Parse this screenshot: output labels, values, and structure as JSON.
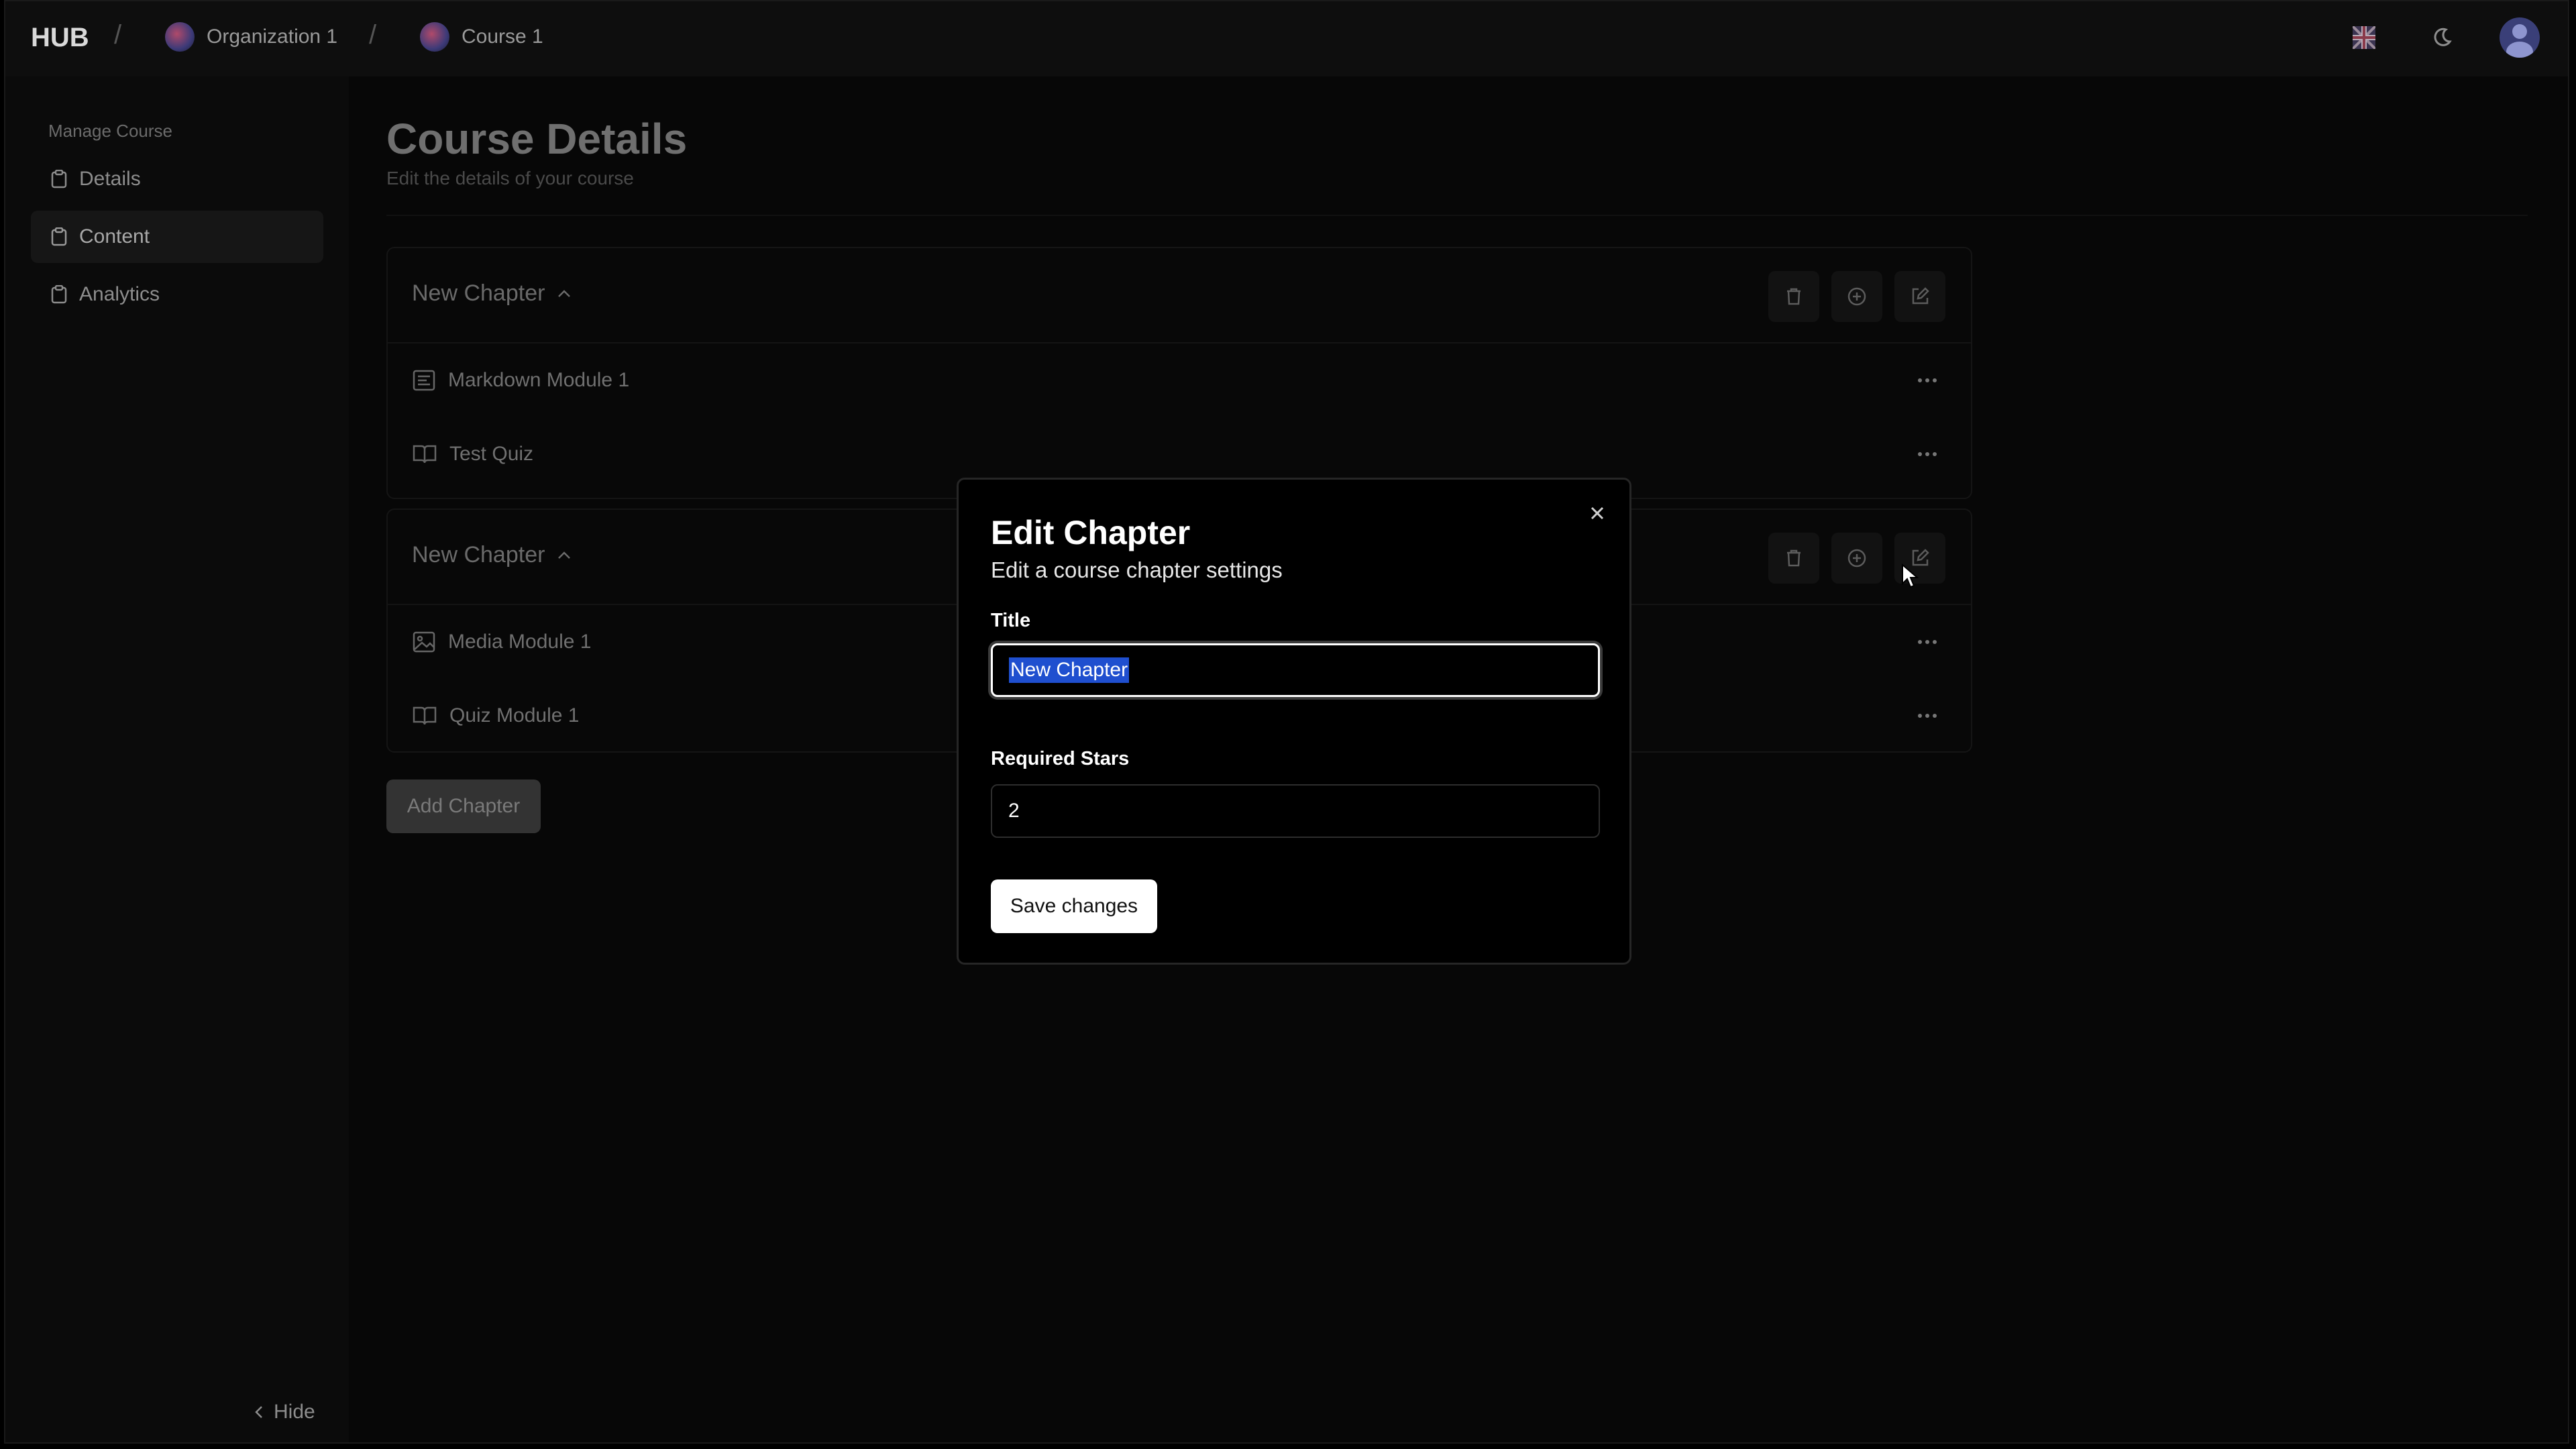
{
  "topbar": {
    "brand": "HUB",
    "breadcrumb": [
      {
        "label": "Organization 1"
      },
      {
        "label": "Course 1"
      }
    ]
  },
  "sidebar": {
    "heading": "Manage Course",
    "items": [
      {
        "label": "Details",
        "icon": "clipboard-icon",
        "active": false
      },
      {
        "label": "Content",
        "icon": "clipboard-icon",
        "active": true
      },
      {
        "label": "Analytics",
        "icon": "clipboard-icon",
        "active": false
      }
    ],
    "hide_label": "Hide"
  },
  "main": {
    "title": "Course Details",
    "subtitle": "Edit the details of your course",
    "chapters": [
      {
        "title": "New Chapter",
        "modules": [
          {
            "label": "Markdown Module 1",
            "icon": "markdown-icon"
          },
          {
            "label": "Test Quiz",
            "icon": "book-open-icon"
          }
        ]
      },
      {
        "title": "New Chapter",
        "modules": [
          {
            "label": "Media Module 1",
            "icon": "image-icon"
          },
          {
            "label": "Quiz Module 1",
            "icon": "book-open-icon"
          }
        ]
      }
    ],
    "add_chapter_label": "Add Chapter"
  },
  "dialog": {
    "title": "Edit Chapter",
    "subtitle": "Edit a course chapter settings",
    "title_label": "Title",
    "title_value": "New Chapter",
    "stars_label": "Required Stars",
    "stars_value": "2",
    "save_label": "Save changes"
  },
  "colors": {
    "background": "#070707",
    "selection": "#1f4fcf",
    "primary_button": "#ffffff"
  }
}
